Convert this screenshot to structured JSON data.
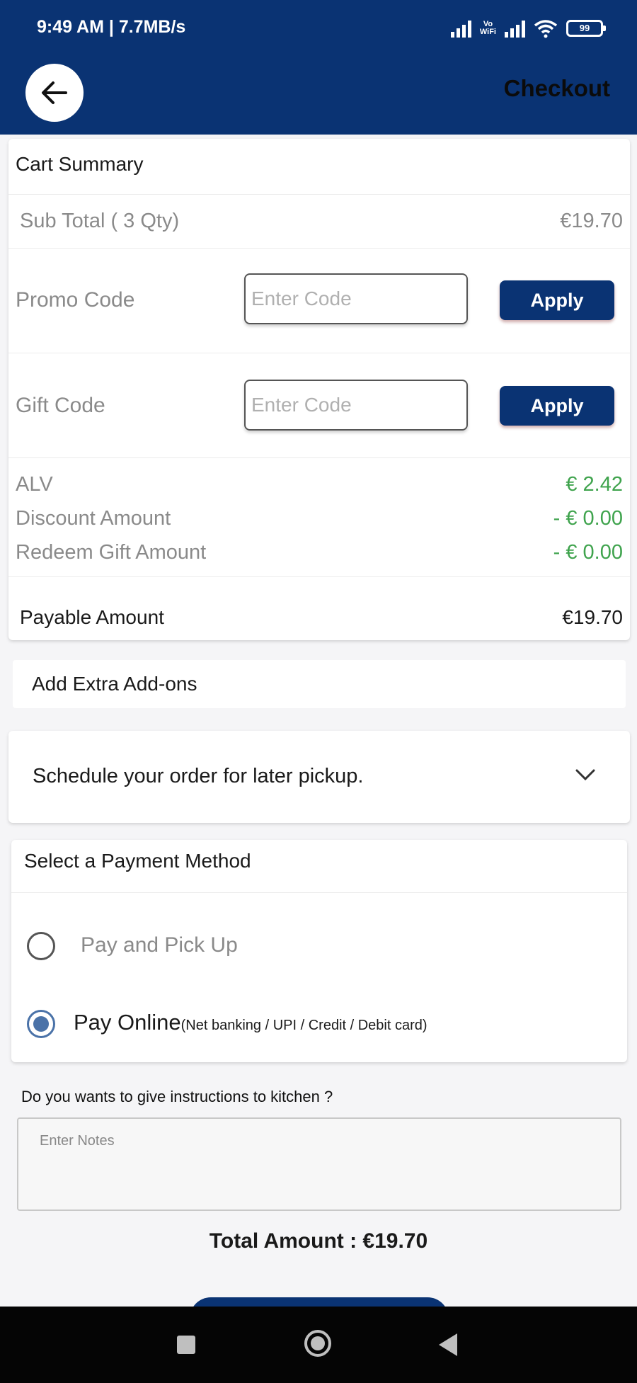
{
  "status_bar": {
    "time": "9:49 AM | 7.7MB/s",
    "volte": "Vo\nWiFi",
    "battery": "99"
  },
  "header": {
    "title": "Checkout"
  },
  "cart_summary": {
    "title": "Cart Summary",
    "subtotal_label": "Sub Total ( 3 Qty)",
    "subtotal_value": "€19.70",
    "promo_label": "Promo Code",
    "promo_placeholder": "Enter Code",
    "promo_button": "Apply",
    "gift_label": "Gift Code",
    "gift_placeholder": "Enter Code",
    "gift_button": "Apply",
    "alv_label": "ALV",
    "alv_value": "€ 2.42",
    "discount_label": "Discount Amount",
    "discount_value": "- € 0.00",
    "redeem_label": "Redeem Gift Amount",
    "redeem_value": "- € 0.00",
    "payable_label": "Payable Amount",
    "payable_value": "€19.70"
  },
  "addons": {
    "label": "Add Extra Add-ons"
  },
  "schedule": {
    "label": "Schedule your order for later pickup."
  },
  "payment": {
    "title": "Select a Payment Method",
    "option_pickup": "Pay and Pick Up",
    "option_online": "Pay Online",
    "option_online_note": "(Net banking / UPI / Credit / Debit card)",
    "selected": "online"
  },
  "instructions": {
    "question": "Do you wants to give instructions to kitchen ?",
    "placeholder": "Enter Notes"
  },
  "total": {
    "text": "Total Amount : €19.70"
  },
  "colors": {
    "primary": "#0a3373",
    "green": "#3fa34d"
  }
}
